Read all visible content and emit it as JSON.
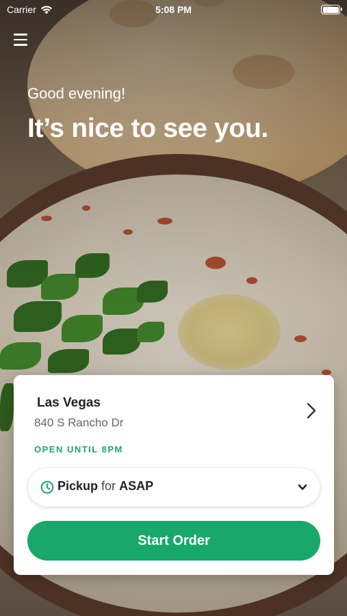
{
  "status_bar": {
    "carrier": "Carrier",
    "time": "5:08 PM"
  },
  "header": {
    "greeting": "Good evening!",
    "headline": "It’s nice to see you."
  },
  "location": {
    "name": "Las Vegas",
    "address": "840 S Rancho Dr",
    "open_status": "OPEN UNTIL 8PM"
  },
  "order_mode": {
    "mode": "Pickup",
    "connector": "for",
    "time": "ASAP"
  },
  "actions": {
    "start_order_label": "Start Order"
  },
  "colors": {
    "accent": "#17a86a",
    "card": "#ffffff",
    "text_primary": "#222222",
    "text_secondary": "#666666"
  },
  "icons": {
    "menu": "hamburger-menu-icon",
    "wifi": "wifi-icon",
    "battery": "battery-icon",
    "location_chevron": "chevron-right-icon",
    "clock": "clock-icon",
    "dropdown": "chevron-down-icon"
  }
}
